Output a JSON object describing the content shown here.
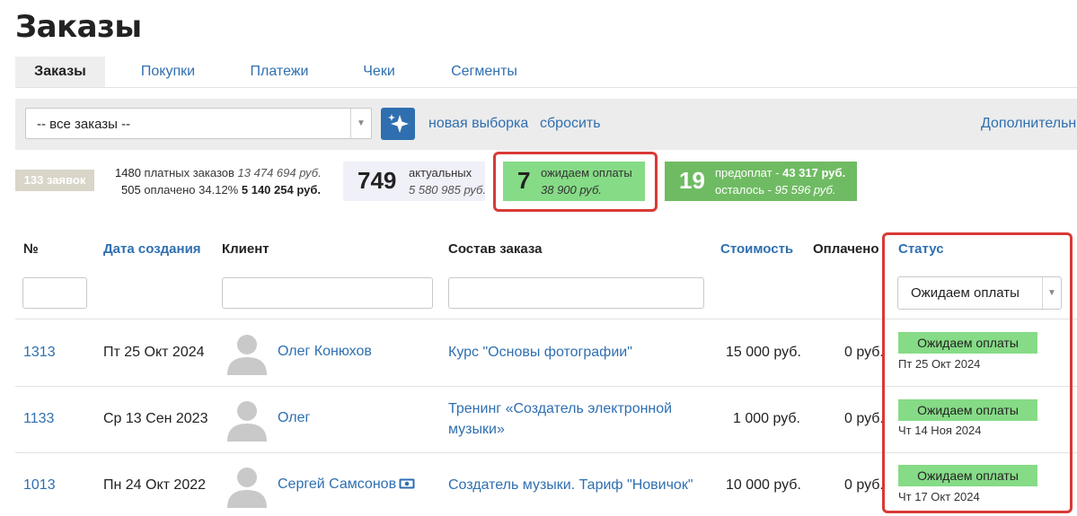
{
  "page": {
    "title": "Заказы"
  },
  "tabs": [
    {
      "label": "Заказы",
      "active": true
    },
    {
      "label": "Покупки"
    },
    {
      "label": "Платежи"
    },
    {
      "label": "Чеки"
    },
    {
      "label": "Сегменты"
    }
  ],
  "filter": {
    "select_value": "-- все заказы --",
    "new_selection": "новая выборка",
    "reset": "сбросить",
    "additional": "Дополнительн"
  },
  "stats": {
    "requests": "133 заявок",
    "paid_orders_count": "1480",
    "paid_orders_label": "платных заказов",
    "paid_orders_sum": "13 474 694 руб.",
    "paid_count": "505",
    "paid_label": "оплачено 34.12%",
    "paid_sum": "5 140 254 руб.",
    "actual_count": "749",
    "actual_label": "актуальных",
    "actual_sum": "5 580 985 руб.",
    "waiting_count": "7",
    "waiting_label": "ожидаем оплаты",
    "waiting_sum": "38 900 руб.",
    "prepay_count": "19",
    "prepay_label": "предоплат - ",
    "prepay_sum": "43 317 руб.",
    "left_label": "осталось - ",
    "left_sum": "95 596 руб."
  },
  "colors": {
    "accent": "#2f6fb0",
    "status_green": "#86db86",
    "highlight_red": "#d83a36",
    "prepay_green": "#6fbb63"
  },
  "table": {
    "headers": {
      "num": "№",
      "created": "Дата создания",
      "client": "Клиент",
      "contents": "Состав заказа",
      "cost": "Стоимость",
      "paid": "Оплачено",
      "status": "Статус"
    },
    "status_filter": "Ожидаем оплаты",
    "rows": [
      {
        "id": "1313",
        "date": "Пт 25 Окт 2024",
        "client": "Олег Конюхов",
        "contents": "Курс \"Основы фотографии\"",
        "cost": "15 000 руб.",
        "paid": "0 руб.",
        "status": "Ожидаем оплаты",
        "status_date": "Пт 25 Окт 2024"
      },
      {
        "id": "1133",
        "date": "Ср 13 Сен 2023",
        "client": "Олег",
        "contents_line1": "Тренинг «Создатель электронной",
        "contents_line2": "музыки»",
        "cost": "1 000 руб.",
        "paid": "0 руб.",
        "status": "Ожидаем оплаты",
        "status_date": "Чт 14 Ноя 2024"
      },
      {
        "id": "1013",
        "date": "Пн 24 Окт 2022",
        "client": "Сергей Самсонов",
        "contents": "Создатель музыки. Тариф \"Новичок\"",
        "cost": "10 000 руб.",
        "paid": "0 руб.",
        "status": "Ожидаем оплаты",
        "status_date": "Чт 17 Окт 2024"
      }
    ]
  }
}
